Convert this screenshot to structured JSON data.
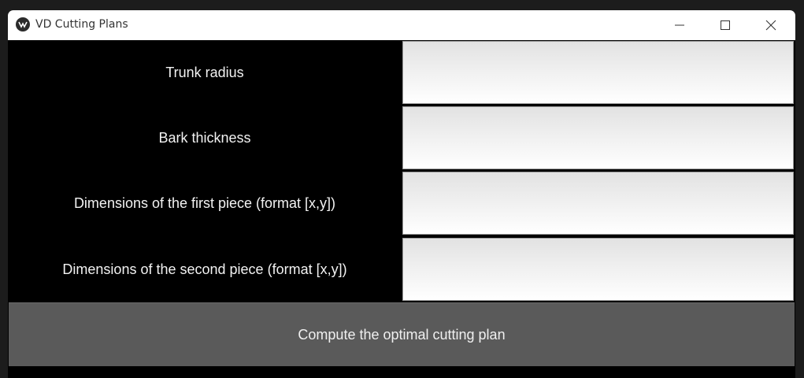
{
  "window": {
    "title": "VD Cutting Plans"
  },
  "titlebar_icons": {
    "app": "app-logo-icon",
    "minimize": "minimize-icon",
    "maximize": "maximize-icon",
    "close": "close-icon"
  },
  "form": {
    "rows": [
      {
        "label": "Trunk radius",
        "value": ""
      },
      {
        "label": "Bark thickness",
        "value": ""
      },
      {
        "label": "Dimensions of the first piece (format [x,y])",
        "value": ""
      },
      {
        "label": "Dimensions of the second piece (format [x,y])",
        "value": ""
      }
    ],
    "submit_label": "Compute the optimal cutting plan"
  },
  "colors": {
    "background": "#000000",
    "button": "#5a5a5a",
    "text": "#f2f2f2"
  }
}
